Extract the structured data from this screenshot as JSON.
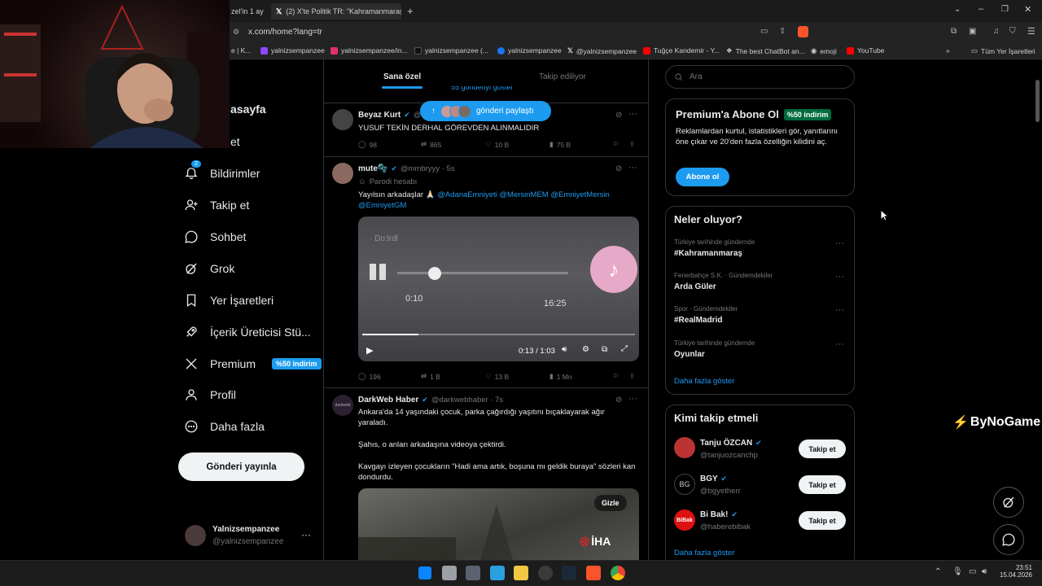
{
  "browser": {
    "tabs": [
      {
        "title": "zel'in 1 ay"
      },
      {
        "title": "(2) X'te Politik TR: \"Kahramanmaraş'ta"
      }
    ],
    "new_tab": "+",
    "url": "x.com/home?lang=tr",
    "bookmarks": [
      "e | K...",
      "yalnizsempanzee",
      "yalnizsempanzee/in...",
      "yalnizsempanzee (...",
      "yalnizsempanzee",
      "@yalnizsempanzee",
      "Tuğçe Kandemir - Y...",
      "The best ChatBot an...",
      "emoji",
      "YouTube"
    ],
    "all_bookmarks": "Tüm Yer İşaretleri"
  },
  "nav": {
    "partial_home": "asayfa",
    "partial_explore": "et",
    "notif_count": "2",
    "notifications": "Bildirimler",
    "follow": "Takip et",
    "chat": "Sohbet",
    "grok": "Grok",
    "bookmarks": "Yer İşaretleri",
    "creator": "İçerik Üreticisi Stü...",
    "premium": "Premium",
    "premium_badge": "%50 indirim",
    "profile": "Profil",
    "more": "Daha fazla",
    "post_button": "Gönderi yayınla",
    "account_name": "Yalnizsempanzee",
    "account_handle": "@yalnizsempanzee"
  },
  "feed": {
    "tab_for_you": "Sana özel",
    "tab_following": "Takip ediliyor",
    "partial_show": "55 gönderiyi göster",
    "new_posts_pill": "gönderi paylaştı",
    "tweets": [
      {
        "name": "Beyaz Kurt",
        "handle": "@",
        "text": "YUSUF TEKİN DERHAL GÖREVDEN ALINMALIDIR",
        "replies": "98",
        "retweets": "865",
        "likes": "10 B",
        "views": "75 B"
      },
      {
        "name": "mute🫧",
        "handle": "@mmbryyy · 5s",
        "parody": "Parodi hesabı",
        "text_a": "Yayılsın arkadaşlar 🙏🏻",
        "mentions": "@AdanaEmniyeti @MersinMEM @EmniyetMersin @EmniyetGM",
        "video_time": "0:13 / 1:03",
        "video_overlay_a": "0:10",
        "video_overlay_b": "16:25",
        "replies": "196",
        "retweets": "1 B",
        "likes": "13 B",
        "views": "1 Mn"
      },
      {
        "name": "DarkWeb Haber",
        "handle": "@darkwebhaber · 7s",
        "p1": "Ankara'da 14 yaşındaki çocuk, parka çağırdığı yaşıtını bıçaklayarak ağır yaraladı.",
        "p2": "Şahıs, o anları arkadaşına videoya çektirdi.",
        "p3": "Kavgayı izleyen çocukların \"Hadi ama artık, boşuna mı geldik buraya\" sözleri kan dondurdu.",
        "hide": "Gizle",
        "watermark": "İHA"
      }
    ]
  },
  "right": {
    "search_placeholder": "Ara",
    "premium_title": "Premium'a Abone Ol",
    "premium_badge": "%50 indirim",
    "premium_text": "Reklamlardan kurtul, istatistikleri gör, yanıtlarını öne çıkar ve 20'den fazla özelliğin kilidini aç.",
    "subscribe": "Abone ol",
    "trends_title": "Neler oluyor?",
    "trends": [
      {
        "cat": "Türkiye tarihinde gündemde",
        "name": "#Kahramanmaraş"
      },
      {
        "cat": "Fenerbahçe S.K. · Gündemdekiler",
        "name": "Arda Güler"
      },
      {
        "cat": "Spor · Gündemdekiler",
        "name": "#RealMadrid"
      },
      {
        "cat": "Türkiye tarihinde gündemde",
        "name": "Oyunlar"
      }
    ],
    "show_more": "Daha fazla göster",
    "who_title": "Kimi takip etmeli",
    "who": [
      {
        "name": "Tanju ÖZCAN",
        "handle": "@tanjuozcanchp",
        "btn": "Takip et"
      },
      {
        "name": "BGY",
        "handle": "@bgyetherr",
        "btn": "Takip et"
      },
      {
        "name": "Bi Bak!",
        "handle": "@haberebibak",
        "btn": "Takip et"
      }
    ],
    "show_more2": "Daha fazla göster"
  },
  "watermark": "ByNoGame",
  "taskbar": {
    "time": "23:51",
    "date": "15.04.2026"
  },
  "colors": {
    "accent": "#1d9bf0",
    "background": "#000000",
    "border": "#2f3336",
    "muted": "#71767b"
  }
}
